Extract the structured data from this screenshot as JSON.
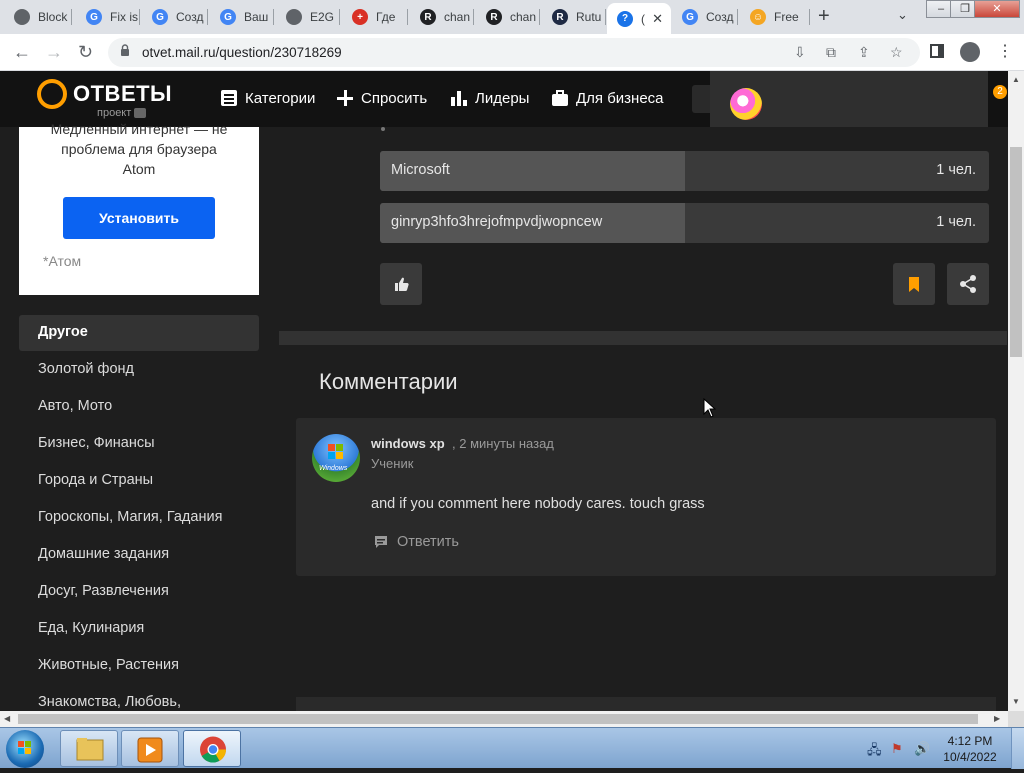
{
  "browser": {
    "tabs": [
      {
        "label": "Block",
        "icon": "globe-icon",
        "color": "#5f6368",
        "glyph": ""
      },
      {
        "label": "Fix is",
        "icon": "google-icon",
        "color": "#4285f4",
        "glyph": "G"
      },
      {
        "label": "Созд",
        "icon": "google-icon",
        "color": "#4285f4",
        "glyph": "G"
      },
      {
        "label": "Ваш",
        "icon": "google-icon",
        "color": "#4285f4",
        "glyph": "G"
      },
      {
        "label": "E2G",
        "icon": "globe-icon",
        "color": "#5f6368",
        "glyph": ""
      },
      {
        "label": "Где",
        "icon": "plus-red-icon",
        "color": "#d93025",
        "glyph": "+"
      },
      {
        "label": "chan",
        "icon": "r-icon",
        "color": "#202124",
        "glyph": "R"
      },
      {
        "label": "chan",
        "icon": "r-icon",
        "color": "#202124",
        "glyph": "R"
      },
      {
        "label": "Rutu",
        "icon": "rutube-icon",
        "color": "#1f2a44",
        "glyph": "R"
      },
      {
        "label": "(",
        "icon": "question-icon",
        "color": "#1a73e8",
        "glyph": "?"
      },
      {
        "label": "Созд",
        "icon": "google-icon",
        "color": "#4285f4",
        "glyph": "G"
      },
      {
        "label": "Free",
        "icon": "smiley-icon",
        "color": "#f4a623",
        "glyph": "☺"
      }
    ],
    "new_tab": "+",
    "url": "otvet.mail.ru/question/230718269"
  },
  "site": {
    "logo": "ОТВЕТЫ",
    "logo_sub": "проект",
    "nav": [
      "Категории",
      "Спросить",
      "Лидеры",
      "Для бизнеса"
    ],
    "notification_count": "2"
  },
  "ad": {
    "text_line1": "Медленный интернет — не",
    "text_line2": "проблема для браузера",
    "text_line3": "Atom",
    "button": "Установить",
    "note": "*Атом"
  },
  "categories": [
    "Другое",
    "Золотой фонд",
    "Авто, Мото",
    "Бизнес, Финансы",
    "Города и Страны",
    "Гороскопы, Магия, Гадания",
    "Домашние задания",
    "Досуг, Развлечения",
    "Еда, Кулинария",
    "Животные, Растения",
    "Знакомства, Любовь,"
  ],
  "poll": [
    {
      "option": "Microsoft",
      "count": "1 чел.",
      "share": 0.5
    },
    {
      "option": "ginryp3hfo3hrejofmpvdjwopncew",
      "count": "1 чел.",
      "share": 0.5
    }
  ],
  "comments": {
    "title": "Комментарии",
    "items": [
      {
        "author": "windows xp",
        "time": ", 2 минуты назад",
        "role": "Ученик",
        "text": "and if you comment here nobody cares. touch grass",
        "reply": "Ответить",
        "avatar_label": "Windows"
      }
    ]
  },
  "taskbar": {
    "time": "4:12 PM",
    "date": "10/4/2022"
  },
  "colors": {
    "accent": "#ff9e00",
    "button_blue": "#0b63f2",
    "bookmark": "#ff9e00"
  }
}
